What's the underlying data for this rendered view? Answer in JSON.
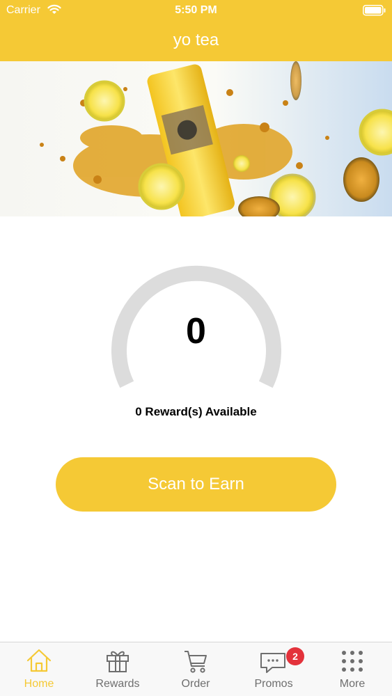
{
  "status_bar": {
    "carrier": "Carrier",
    "time": "5:50 PM"
  },
  "header": {
    "title": "yo tea"
  },
  "banner": {
    "image": "yo tea drink with lemon slices splash"
  },
  "rewards": {
    "points": "0",
    "available_text": "0 Reward(s) Available",
    "progress_fraction": 0
  },
  "scan_button": {
    "label": "Scan to Earn"
  },
  "tab_bar": {
    "tabs": [
      {
        "label": "Home",
        "icon": "home-icon",
        "active": true
      },
      {
        "label": "Rewards",
        "icon": "gift-icon",
        "active": false
      },
      {
        "label": "Order",
        "icon": "cart-icon",
        "active": false
      },
      {
        "label": "Promos",
        "icon": "chat-bubble-icon",
        "active": false,
        "badge": "2"
      },
      {
        "label": "More",
        "icon": "grid-dots-icon",
        "active": false
      }
    ]
  },
  "colors": {
    "accent": "#f5c935",
    "badge": "#e3323b",
    "gauge_track": "#dcdcdc",
    "tab_inactive": "#6e6e6e"
  }
}
